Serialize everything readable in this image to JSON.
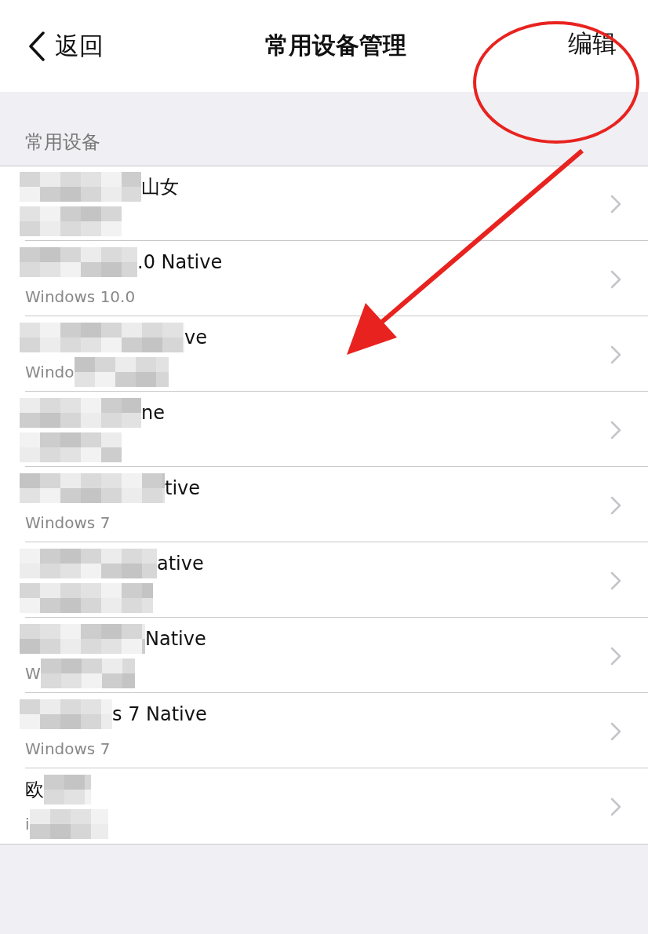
{
  "nav": {
    "back": "返回",
    "title": "常用设备管理",
    "action": "编辑"
  },
  "section": {
    "header": "常用设备"
  },
  "devices": [
    {
      "kind": "masked-start",
      "title": "山女"
    },
    {
      "kind": "masked-start",
      "title": ".0 Native",
      "subtitle": "Windows 10.0"
    },
    {
      "kind": "masked-start",
      "title": "ve",
      "subtitle": "Windo"
    },
    {
      "kind": "masked-start",
      "title": "ne"
    },
    {
      "kind": "masked-start",
      "title": "tive",
      "subtitle": "Windows 7"
    },
    {
      "kind": "masked-start",
      "title": "ative"
    },
    {
      "kind": "masked-start",
      "title": "Native",
      "subtitle": "W"
    },
    {
      "kind": "masked-start",
      "title": "s 7 Native",
      "subtitle": "Windows 7"
    },
    {
      "kind": "masked-end",
      "title": "欧",
      "subtitle": "i"
    }
  ]
}
